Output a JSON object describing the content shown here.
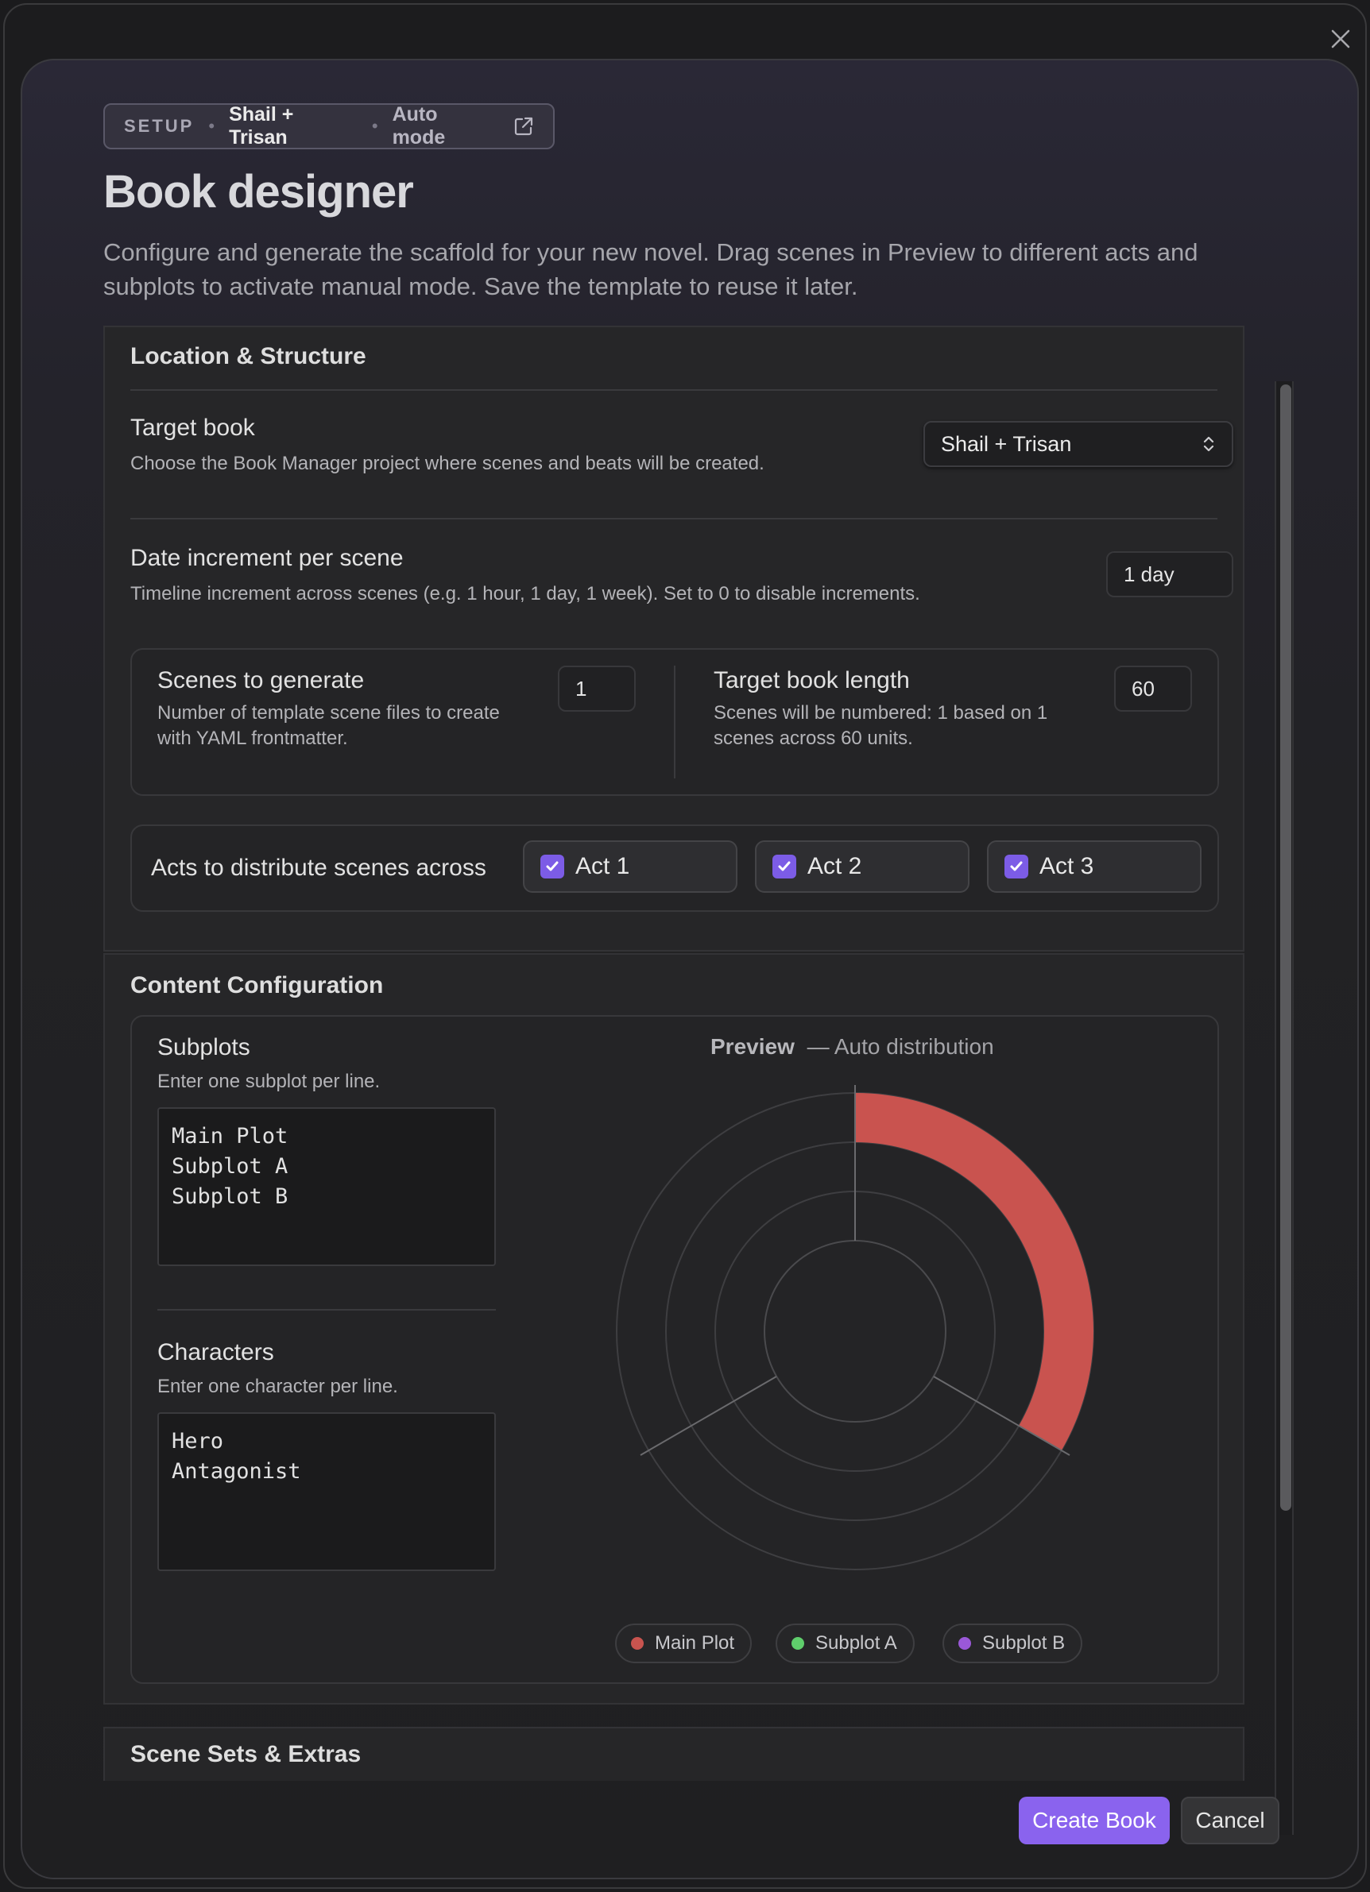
{
  "header": {
    "setup_label": "SETUP",
    "book_name": "Shail + Trisan",
    "mode_label": "Auto mode",
    "title": "Book designer",
    "description": "Configure and generate the scaffold for your new novel. Drag scenes in Preview to different acts and subplots to activate manual mode. Save the template to reuse it later."
  },
  "location_structure": {
    "section_title": "Location & Structure",
    "target_book": {
      "label": "Target book",
      "description": "Choose the Book Manager project where scenes and beats will be created.",
      "selected": "Shail + Trisan"
    },
    "date_increment": {
      "label": "Date increment per scene",
      "description": "Timeline increment across scenes (e.g. 1 hour, 1 day, 1 week). Set to 0 to disable increments.",
      "value": "1 day"
    },
    "scenes_to_generate": {
      "label": "Scenes to generate",
      "description": "Number of template scene files to create with YAML frontmatter.",
      "value": "1"
    },
    "target_book_length": {
      "label": "Target book length",
      "description": "Scenes will be numbered: 1 based on 1 scenes across 60 units.",
      "value": "60"
    },
    "acts": {
      "label": "Acts to distribute scenes across",
      "items": [
        {
          "label": "Act 1",
          "checked": true
        },
        {
          "label": "Act 2",
          "checked": true
        },
        {
          "label": "Act 3",
          "checked": true
        }
      ]
    }
  },
  "content_configuration": {
    "section_title": "Content Configuration",
    "subplots": {
      "label": "Subplots",
      "description": "Enter one subplot per line.",
      "lines": [
        "Main Plot",
        "Subplot A",
        "Subplot B"
      ]
    },
    "characters": {
      "label": "Characters",
      "description": "Enter one character per line.",
      "lines": [
        "Hero",
        "Antagonist"
      ]
    },
    "preview": {
      "title": "Preview",
      "subtitle": "— Auto distribution",
      "legend": [
        {
          "name": "Main Plot",
          "color": "#c9544f"
        },
        {
          "name": "Subplot A",
          "color": "#5fce6c"
        },
        {
          "name": "Subplot B",
          "color": "#9a58d8"
        }
      ],
      "highlight_color": "#c9534f"
    }
  },
  "scene_sets": {
    "section_title": "Scene Sets & Extras"
  },
  "footer": {
    "create_label": "Create Book",
    "cancel_label": "Cancel"
  },
  "colors": {
    "accent": "#8a63ee",
    "checkbox": "#7c5ce6"
  }
}
